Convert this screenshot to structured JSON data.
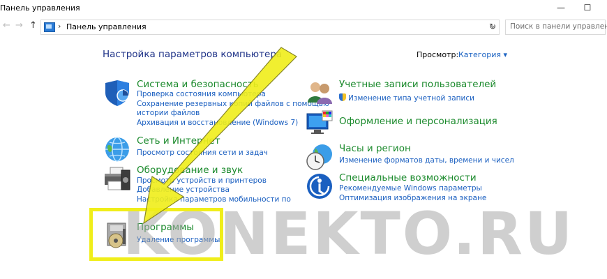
{
  "window": {
    "title": "Панель управления",
    "min": "—",
    "max": "☐"
  },
  "nav": {
    "back": "←",
    "forward": "→",
    "up": "↑"
  },
  "address": {
    "separator": "›",
    "location": "Панель управления",
    "dropdown": "⌄",
    "refresh": "↻"
  },
  "search": {
    "placeholder": "Поиск в панели управления"
  },
  "heading": "Настройка параметров компьютера",
  "view": {
    "label": "Просмотр:",
    "value": "Категория ▾"
  },
  "categories": [
    {
      "title": "Система и безопасность",
      "links": [
        "Проверка состояния компьютера",
        "Сохранение резервных копий файлов с помощью",
        "истории файлов",
        "Архивация и восстановление (Windows 7)"
      ]
    },
    {
      "title": "Сеть и Интернет",
      "links": [
        "Просмотр состояния сети и задач"
      ]
    },
    {
      "title": "Оборудование и звук",
      "links": [
        "Просмотр устройств и принтеров",
        "Добавление устройства",
        "Настройка параметров мобильности по"
      ]
    },
    {
      "title": "Программы",
      "links": [
        "Удаление программы"
      ]
    },
    {
      "title": "Учетные записи пользователей",
      "links": [
        "Изменение типа учетной записи"
      ]
    },
    {
      "title": "Оформление и персонализация",
      "links": []
    },
    {
      "title": "Часы и регион",
      "links": [
        "Изменение форматов даты, времени и чисел"
      ]
    },
    {
      "title": "Специальные возможности",
      "links": [
        "Рекомендуемые Windows параметры",
        "Оптимизация изображения на экране"
      ]
    }
  ],
  "watermark": "KONEKTO.RU",
  "colors": {
    "highlight": "#f0ee1a",
    "title_green": "#1b8a2c",
    "link_blue": "#1a5fc0",
    "heading_blue": "#1e3287"
  }
}
